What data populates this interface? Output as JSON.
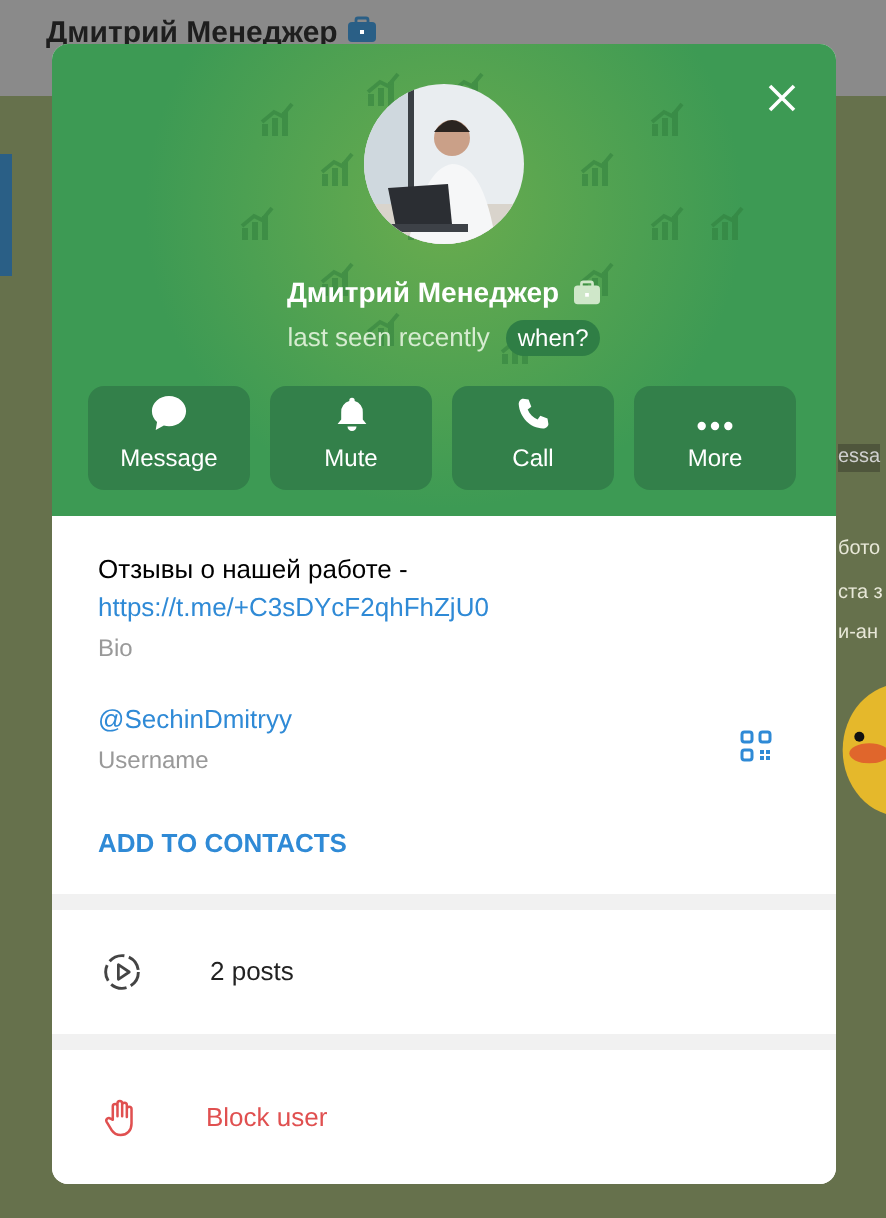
{
  "background": {
    "chat_title": "Дмитрий Менеджер",
    "fragments": [
      "essa",
      "бото",
      "ста з",
      "и-ан"
    ]
  },
  "profile": {
    "name": "Дмитрий Менеджер",
    "status": "last seen recently",
    "when_button": "when?",
    "actions": [
      {
        "kind": "message",
        "label": "Message"
      },
      {
        "kind": "mute",
        "label": "Mute"
      },
      {
        "kind": "call",
        "label": "Call"
      },
      {
        "kind": "more",
        "label": "More"
      }
    ]
  },
  "info": {
    "bio": "Отзывы о нашей работе -",
    "bio_link": "https://t.me/+C3sDYcF2qhFhZjU0",
    "bio_label": "Bio",
    "username": "@SechinDmitryy",
    "username_label": "Username",
    "add_contact": "ADD TO CONTACTS"
  },
  "posts": {
    "label": "2 posts"
  },
  "block": {
    "label": "Block user"
  }
}
